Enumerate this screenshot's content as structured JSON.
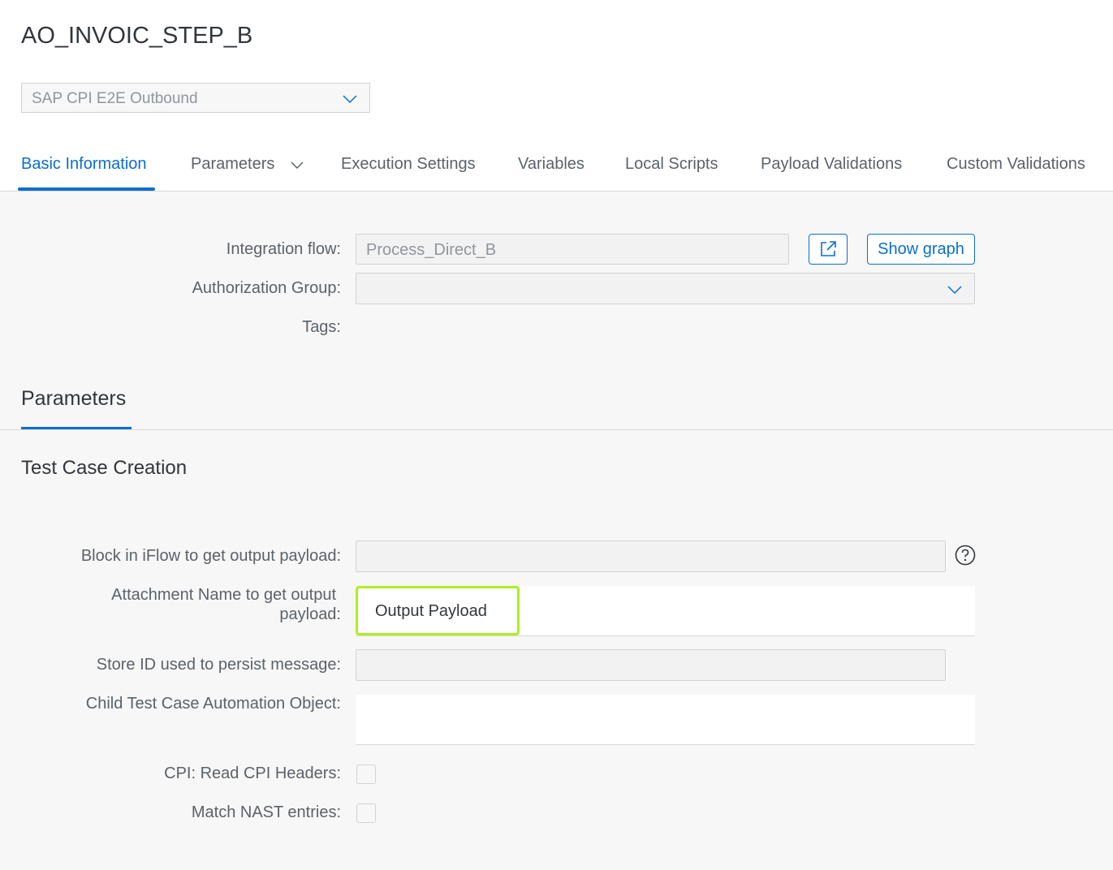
{
  "page": {
    "title": "AO_INVOIC_STEP_B"
  },
  "automation_select": {
    "value": "SAP CPI E2E Outbound",
    "icon": "chevron-down-icon"
  },
  "tabs": [
    {
      "label": "Basic Information",
      "active": true
    },
    {
      "label": "Parameters",
      "has_dropdown": true
    },
    {
      "label": "Execution Settings"
    },
    {
      "label": "Variables"
    },
    {
      "label": "Local Scripts"
    },
    {
      "label": "Payload Validations"
    },
    {
      "label": "Custom Validations"
    }
  ],
  "basic_info": {
    "integration_flow_label": "Integration flow:",
    "integration_flow_value": "Process_Direct_B",
    "open_icon": "external-link-icon",
    "show_graph_label": "Show graph",
    "authorization_group_label": "Authorization Group:",
    "authorization_group_value": "",
    "tags_label": "Tags:"
  },
  "parameters_section": {
    "title": "Parameters",
    "subsection_title": "Test Case Creation",
    "block_label": "Block in iFlow to get output payload:",
    "block_value": "",
    "help_icon": "question-mark-icon",
    "attachment_label_line1": "Attachment Name to get output",
    "attachment_label_line2": "payload:",
    "attachment_value": "Output Payload",
    "store_id_label": "Store ID used to persist message:",
    "store_id_value": "",
    "child_test_case_label": "Child Test Case Automation Object:",
    "read_headers_label": "CPI: Read CPI Headers:",
    "read_headers_checked": false,
    "match_nast_label": "Match NAST entries:",
    "match_nast_checked": false
  },
  "colors": {
    "accent": "#0a6ed1",
    "highlight": "#adf01d",
    "background": "#f7f7f7"
  }
}
